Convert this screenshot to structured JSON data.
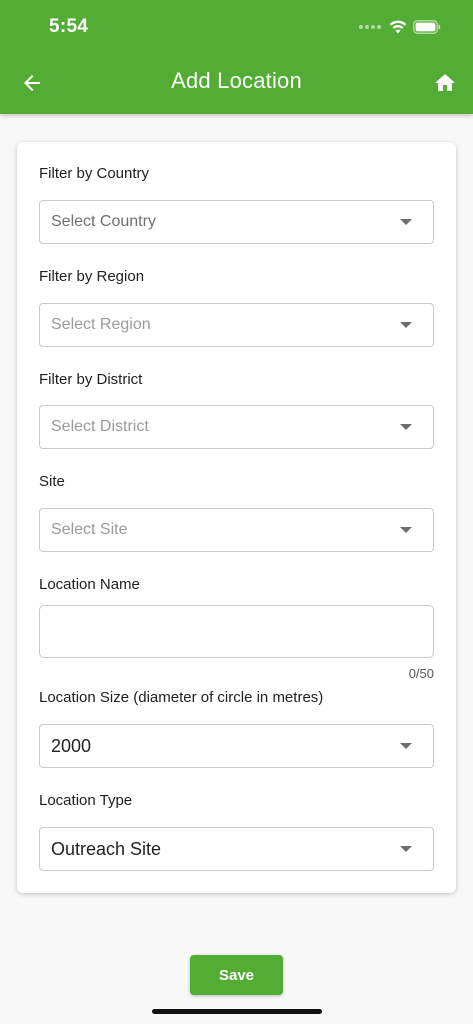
{
  "status_bar": {
    "time": "5:54"
  },
  "header": {
    "title": "Add Location"
  },
  "form": {
    "country": {
      "label": "Filter by Country",
      "placeholder": "Select Country"
    },
    "region": {
      "label": "Filter by Region",
      "placeholder": "Select Region"
    },
    "district": {
      "label": "Filter by District",
      "placeholder": "Select District"
    },
    "site": {
      "label": "Site",
      "placeholder": "Select Site"
    },
    "location_name": {
      "label": "Location Name",
      "value": "",
      "counter": "0/50"
    },
    "location_size": {
      "label": "Location Size (diameter of circle in metres)",
      "value": "2000"
    },
    "location_type": {
      "label": "Location Type",
      "value": "Outreach Site"
    }
  },
  "actions": {
    "save_label": "Save"
  },
  "colors": {
    "brand": "#53ac33"
  }
}
